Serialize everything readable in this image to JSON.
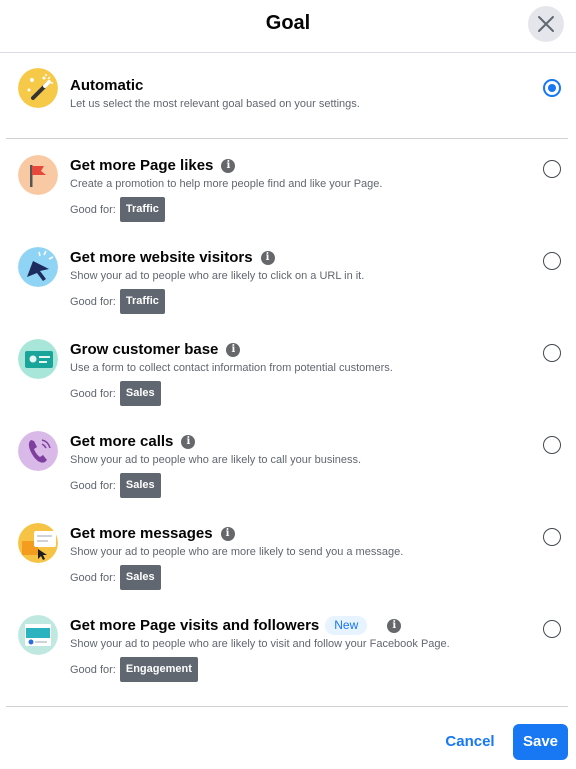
{
  "dialog": {
    "title": "Goal"
  },
  "options": [
    {
      "title": "Automatic",
      "description": "Let us select the most relevant goal based on your settings.",
      "selected": true
    },
    {
      "title": "Get more Page likes",
      "description": "Create a promotion to help more people find and like your Page.",
      "good_for_label": "Good for:",
      "good_for": "Traffic",
      "selected": false
    },
    {
      "title": "Get more website visitors",
      "description": "Show your ad to people who are likely to click on a URL in it.",
      "good_for_label": "Good for:",
      "good_for": "Traffic",
      "selected": false
    },
    {
      "title": "Grow customer base",
      "description": "Use a form to collect contact information from potential customers.",
      "good_for_label": "Good for:",
      "good_for": "Sales",
      "selected": false
    },
    {
      "title": "Get more calls",
      "description": "Show your ad to people who are likely to call your business.",
      "good_for_label": "Good for:",
      "good_for": "Sales",
      "selected": false
    },
    {
      "title": "Get more messages",
      "description": "Show your ad to people who are more likely to send you a message.",
      "good_for_label": "Good for:",
      "good_for": "Sales",
      "selected": false
    },
    {
      "title": "Get more Page visits and followers",
      "badge": "New",
      "description": "Show your ad to people who are likely to visit and follow your Facebook Page.",
      "good_for_label": "Good for:",
      "good_for": "Engagement",
      "selected": false
    }
  ],
  "footer": {
    "cancel_label": "Cancel",
    "save_label": "Save"
  },
  "colors": {
    "accent": "#1877f2",
    "tag_bg": "#606770",
    "new_badge_bg": "#e7f3ff"
  },
  "icons": [
    "magic-wand-icon",
    "flag-icon",
    "cursor-click-icon",
    "contact-card-icon",
    "phone-icon",
    "message-icon",
    "page-visit-icon"
  ]
}
